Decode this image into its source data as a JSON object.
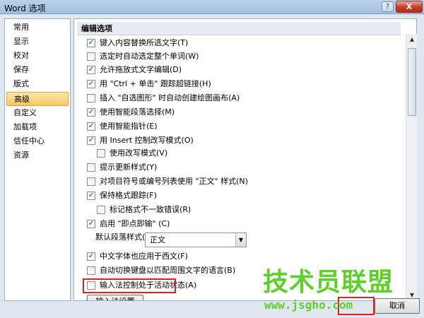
{
  "window": {
    "title": "Word 选项",
    "help": "?",
    "close": "X"
  },
  "sidebar": {
    "items": [
      {
        "label": "常用"
      },
      {
        "label": "显示"
      },
      {
        "label": "校对"
      },
      {
        "label": "保存"
      },
      {
        "label": "版式"
      },
      {
        "label": "高级",
        "selected": true
      },
      {
        "label": "自定义"
      },
      {
        "label": "加载项"
      },
      {
        "label": "信任中心"
      },
      {
        "label": "资源"
      }
    ]
  },
  "content": {
    "section_title": "编辑选项",
    "options": [
      {
        "label": "键入内容替换所选文字(T)",
        "checked": true
      },
      {
        "label": "选定时自动选定整个单词(W)",
        "checked": false
      },
      {
        "label": "允许拖放式文字编辑(D)",
        "checked": true
      },
      {
        "label": "用 \"Ctrl + 单击\" 跟踪超链接(H)",
        "checked": true
      },
      {
        "label": "插入 \"自选图形\" 时自动创建绘图画布(A)",
        "checked": false
      },
      {
        "label": "使用智能段落选择(M)",
        "checked": true
      },
      {
        "label": "使用智能指针(E)",
        "checked": true
      },
      {
        "label": "用 Insert 控制改写模式(O)",
        "checked": true
      },
      {
        "label": "使用改写模式(V)",
        "checked": false
      },
      {
        "label": "提示更新样式(Y)",
        "checked": false
      },
      {
        "label": "对项目符号或编号列表使用 \"正文\" 样式(N)",
        "checked": false
      },
      {
        "label": "保持格式跟踪(F)",
        "checked": true
      },
      {
        "label": "标记格式不一致错误(R)",
        "checked": false
      },
      {
        "label": "启用 \"即点即输\" (C)",
        "checked": true
      }
    ],
    "default_para_style_label": "默认段落样式(Y):",
    "default_para_style_value": "正文",
    "options2": [
      {
        "label": "中文字体也应用于西文(F)",
        "checked": true
      },
      {
        "label": "自动切换键盘以匹配周围文字的语言(B)",
        "checked": false
      },
      {
        "label": "输入法控制处于活动状态(A)",
        "checked": false
      }
    ],
    "ime_settings_button": "输入法设置(M)..."
  },
  "footer": {
    "cancel_label": "取消"
  },
  "watermark": {
    "title": "技术员联盟",
    "url": "www.jsgho.com"
  },
  "colors": {
    "highlight_red": "#e02020",
    "selected_bg": "#f8c760",
    "watermark_green": "#5fcf2c"
  }
}
